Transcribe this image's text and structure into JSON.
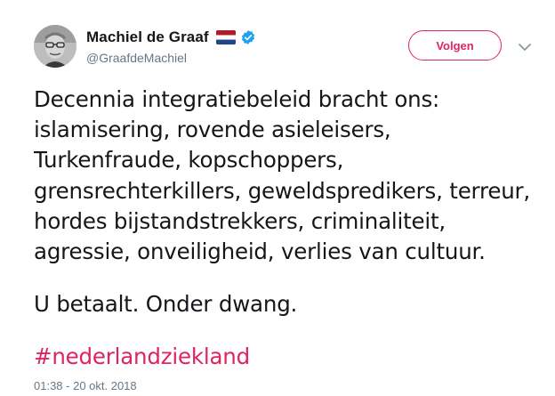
{
  "author": {
    "display_name": "Machiel de Graaf",
    "handle": "@GraafdeMachiel",
    "flag_icon": "netherlands-flag-icon",
    "verified_icon": "verified-badge-icon"
  },
  "follow_button": {
    "label": "Volgen",
    "color": "#e0245e"
  },
  "menu_icon": "chevron-down-icon",
  "tweet": {
    "lines": [
      "Decennia integratiebeleid bracht ons:",
      "islamisering, rovende asieleisers,",
      "Turkenfraude, kopschoppers,",
      "grensrechterkillers, geweldspredikers, terreur,",
      "hordes bijstandstrekkers, criminaliteit,",
      "agressie, onveiligheid, verlies van cultuur."
    ],
    "closing": "U betaalt. Onder dwang.",
    "hashtag": "#nederlandziekland",
    "timestamp": "01:38 - 20 okt. 2018"
  },
  "colors": {
    "text": "#14171a",
    "secondary": "#657786",
    "accent": "#e0245e",
    "verified": "#1da1f2"
  }
}
